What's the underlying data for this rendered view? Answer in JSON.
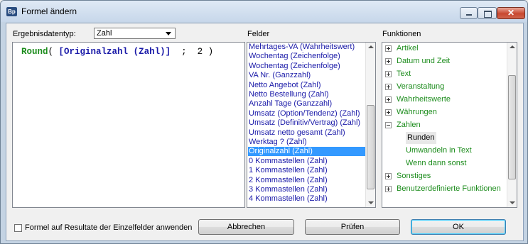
{
  "window": {
    "title": "Formel ändern",
    "app_icon": "Bp",
    "buttons": {
      "minimize": "minimize-icon",
      "maximize": "maximize-icon",
      "close": "✕"
    }
  },
  "result_type": {
    "label": "Ergebnisdatentyp:",
    "value": "Zahl"
  },
  "formula": {
    "function": "Round",
    "open_paren": "(",
    "field": "[Originalzahl (Zahl)]",
    "rest": ";  2 )"
  },
  "fields": {
    "header": "Felder",
    "items": [
      "Mehrtages-VA (Wahrheitswert)",
      "Wochentag (Zeichenfolge)",
      "Wochentag (Zeichenfolge)",
      "VA Nr. (Ganzzahl)",
      "Netto Angebot (Zahl)",
      "Netto Bestellung (Zahl)",
      "Anzahl Tage (Ganzzahl)",
      "Umsatz (Option/Tendenz) (Zahl)",
      "Umsatz (Definitiv/Vertrag) (Zahl)",
      "Umsatz netto gesamt (Zahl)",
      "Werktag ? (Zahl)",
      "Originalzahl (Zahl)",
      "0 Kommastellen (Zahl)",
      "1 Kommastellen (Zahl)",
      "2 Kommastellen (Zahl)",
      "3 Kommastellen (Zahl)",
      "4 Kommastellen (Zahl)"
    ],
    "selected_index": 11
  },
  "functions": {
    "header": "Funktionen",
    "items": [
      {
        "label": "Artikel",
        "expander": "+",
        "level": 0
      },
      {
        "label": "Datum und Zeit",
        "expander": "+",
        "level": 0
      },
      {
        "label": "Text",
        "expander": "+",
        "level": 0
      },
      {
        "label": "Veranstaltung",
        "expander": "+",
        "level": 0
      },
      {
        "label": "Wahrheitswerte",
        "expander": "+",
        "level": 0
      },
      {
        "label": "Währungen",
        "expander": "+",
        "level": 0
      },
      {
        "label": "Zahlen",
        "expander": "-",
        "level": 0
      },
      {
        "label": "Runden",
        "expander": "",
        "level": 1,
        "highlighted": true
      },
      {
        "label": "Umwandeln in Text",
        "expander": "",
        "level": 1
      },
      {
        "label": "Wenn dann sonst",
        "expander": "",
        "level": 1
      },
      {
        "label": "Sonstiges",
        "expander": "+",
        "level": 0
      },
      {
        "label": "Benutzerdefinierte Funktionen",
        "expander": "+",
        "level": 0
      }
    ]
  },
  "footer": {
    "apply_checkbox_label": "Formel auf Resultate der Einzelfelder anwenden",
    "apply_checked": false,
    "cancel_label": "Abbrechen",
    "check_label": "Prüfen",
    "ok_label": "OK"
  },
  "colors": {
    "field_text": "#1a1aa8",
    "function_text": "#1c8c1c",
    "selection": "#3399ff"
  }
}
